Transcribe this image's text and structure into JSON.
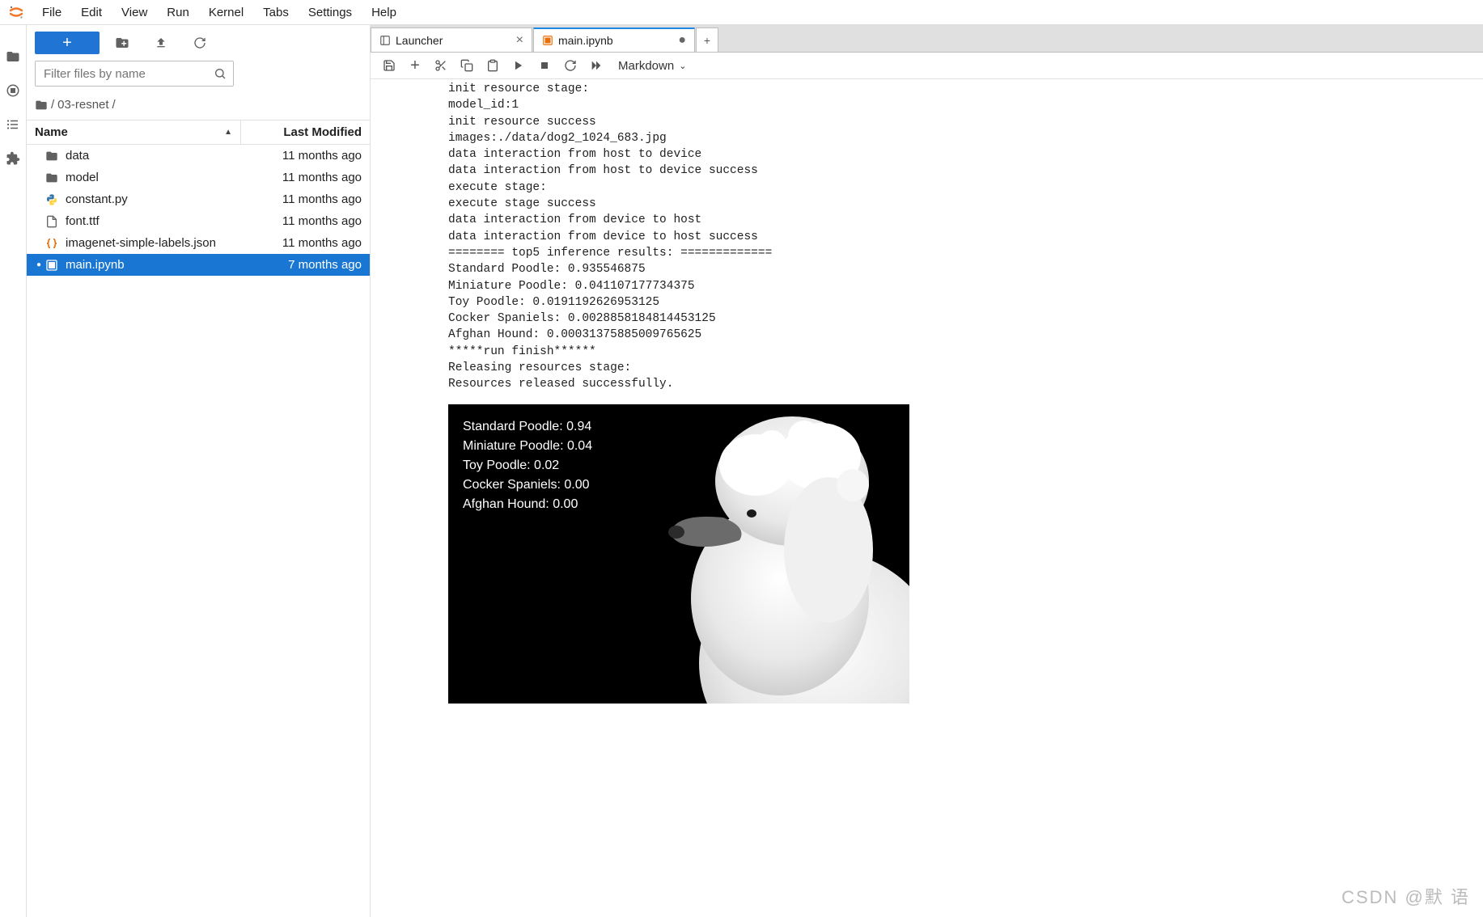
{
  "menu": {
    "items": [
      "File",
      "Edit",
      "View",
      "Run",
      "Kernel",
      "Tabs",
      "Settings",
      "Help"
    ]
  },
  "filepanel": {
    "filter_placeholder": "Filter files by name",
    "breadcrumb": {
      "folder": "03-resnet",
      "sep": "/"
    },
    "header": {
      "name": "Name",
      "modified": "Last Modified"
    },
    "items": [
      {
        "icon": "folder",
        "name": "data",
        "modified": "11 months ago",
        "selected": false,
        "running": false
      },
      {
        "icon": "folder",
        "name": "model",
        "modified": "11 months ago",
        "selected": false,
        "running": false
      },
      {
        "icon": "python",
        "name": "constant.py",
        "modified": "11 months ago",
        "selected": false,
        "running": false
      },
      {
        "icon": "file",
        "name": "font.ttf",
        "modified": "11 months ago",
        "selected": false,
        "running": false
      },
      {
        "icon": "json",
        "name": "imagenet-simple-labels.json",
        "modified": "11 months ago",
        "selected": false,
        "running": false
      },
      {
        "icon": "notebook",
        "name": "main.ipynb",
        "modified": "7 months ago",
        "selected": true,
        "running": true
      }
    ]
  },
  "tabs": [
    {
      "icon": "launcher",
      "label": "Launcher",
      "active": false,
      "closable": true,
      "dirty": false
    },
    {
      "icon": "notebook",
      "label": "main.ipynb",
      "active": true,
      "closable": true,
      "dirty": true
    }
  ],
  "nb_toolbar": {
    "celltype_label": "Markdown"
  },
  "output": {
    "lines": [
      "init resource stage:",
      "model_id:1",
      "init resource success",
      "images:./data/dog2_1024_683.jpg",
      "data interaction from host to device",
      "data interaction from host to device success",
      "execute stage:",
      "execute stage success",
      "data interaction from device to host",
      "data interaction from device to host success",
      "======== top5 inference results: =============",
      "Standard Poodle: 0.935546875",
      "Miniature Poodle: 0.041107177734375",
      "Toy Poodle: 0.0191192626953125",
      "Cocker Spaniels: 0.0028858184814453125",
      "Afghan Hound: 0.00031375885009765625",
      "*****run finish******",
      "Releasing resources stage:",
      "Resources released successfully."
    ],
    "image_overlay": [
      "Standard Poodle: 0.94",
      "Miniature Poodle: 0.04",
      "Toy Poodle: 0.02",
      "Cocker Spaniels: 0.00",
      "Afghan Hound: 0.00"
    ]
  },
  "watermark": "CSDN @默  语"
}
